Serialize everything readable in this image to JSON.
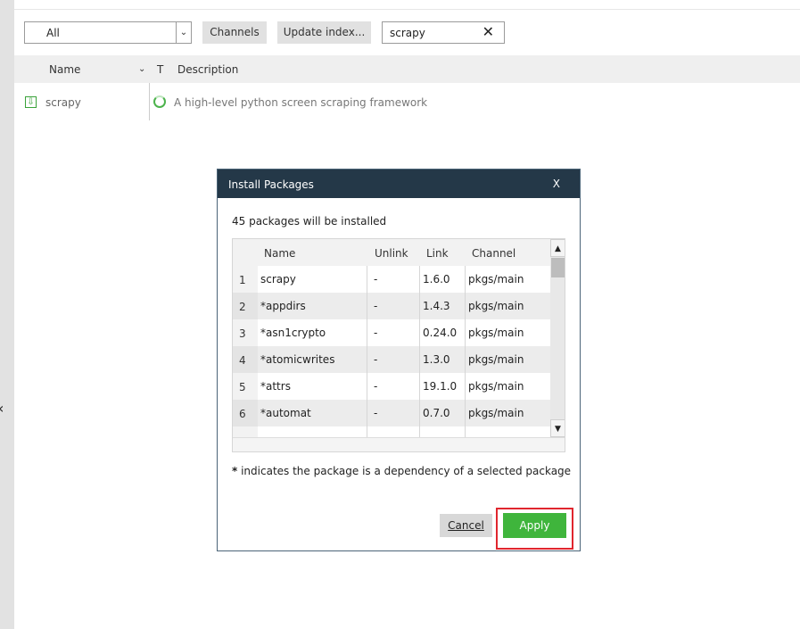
{
  "toolbar": {
    "filter_value": "All",
    "channels_label": "Channels",
    "update_index_label": "Update index...",
    "search_value": "scrapy",
    "clear_icon": "close-icon"
  },
  "package_list": {
    "headers": {
      "name": "Name",
      "type": "T",
      "description": "Description"
    },
    "rows": [
      {
        "name": "scrapy",
        "description": "A high-level python screen scraping framework",
        "status_icon": "loading-ring-icon",
        "selected_icon": "install-marked-icon"
      }
    ]
  },
  "dialog": {
    "title": "Install Packages",
    "close_label": "X",
    "info": "45 packages will be installed",
    "table": {
      "headers": [
        "Name",
        "Unlink",
        "Link",
        "Channel"
      ],
      "rows": [
        {
          "num": "1",
          "name": "scrapy",
          "unlink": "-",
          "link": "1.6.0",
          "channel": "pkgs/main"
        },
        {
          "num": "2",
          "name": "*appdirs",
          "unlink": "-",
          "link": "1.4.3",
          "channel": "pkgs/main"
        },
        {
          "num": "3",
          "name": "*asn1crypto",
          "unlink": "-",
          "link": "0.24.0",
          "channel": "pkgs/main"
        },
        {
          "num": "4",
          "name": "*atomicwrites",
          "unlink": "-",
          "link": "1.3.0",
          "channel": "pkgs/main"
        },
        {
          "num": "5",
          "name": "*attrs",
          "unlink": "-",
          "link": "19.1.0",
          "channel": "pkgs/main"
        },
        {
          "num": "6",
          "name": "*automat",
          "unlink": "-",
          "link": "0.7.0",
          "channel": "pkgs/main"
        }
      ]
    },
    "note_star": "*",
    "note_text": " indicates the package is a dependency of a selected package",
    "cancel_label": "Cancel",
    "apply_label": "Apply",
    "highlight_color": "#e0262e",
    "apply_color": "#3fb53c"
  }
}
